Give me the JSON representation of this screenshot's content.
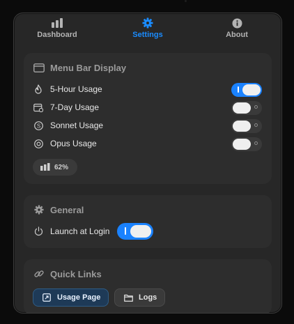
{
  "tabs": [
    {
      "label": "Dashboard",
      "icon": "bar-chart-icon",
      "active": false
    },
    {
      "label": "Settings",
      "icon": "gear-icon",
      "active": true
    },
    {
      "label": "About",
      "icon": "info-icon",
      "active": false
    }
  ],
  "menu_bar_display": {
    "title": "Menu Bar Display",
    "items": [
      {
        "label": "5-Hour Usage",
        "icon": "flame-icon",
        "enabled": true
      },
      {
        "label": "7-Day Usage",
        "icon": "calendar-clock-icon",
        "enabled": false
      },
      {
        "label": "Sonnet Usage",
        "icon": "s-circle-icon",
        "enabled": false
      },
      {
        "label": "Opus Usage",
        "icon": "target-circle-icon",
        "enabled": false
      }
    ],
    "preview_value": "62%"
  },
  "general": {
    "title": "General",
    "launch_at_login_label": "Launch at Login",
    "launch_at_login_enabled": true
  },
  "quick_links": {
    "title": "Quick Links",
    "usage_page_label": "Usage Page",
    "logs_label": "Logs"
  },
  "colors": {
    "accent": "#1a82ff",
    "panel": "#272727",
    "card": "#2d2d2d"
  }
}
